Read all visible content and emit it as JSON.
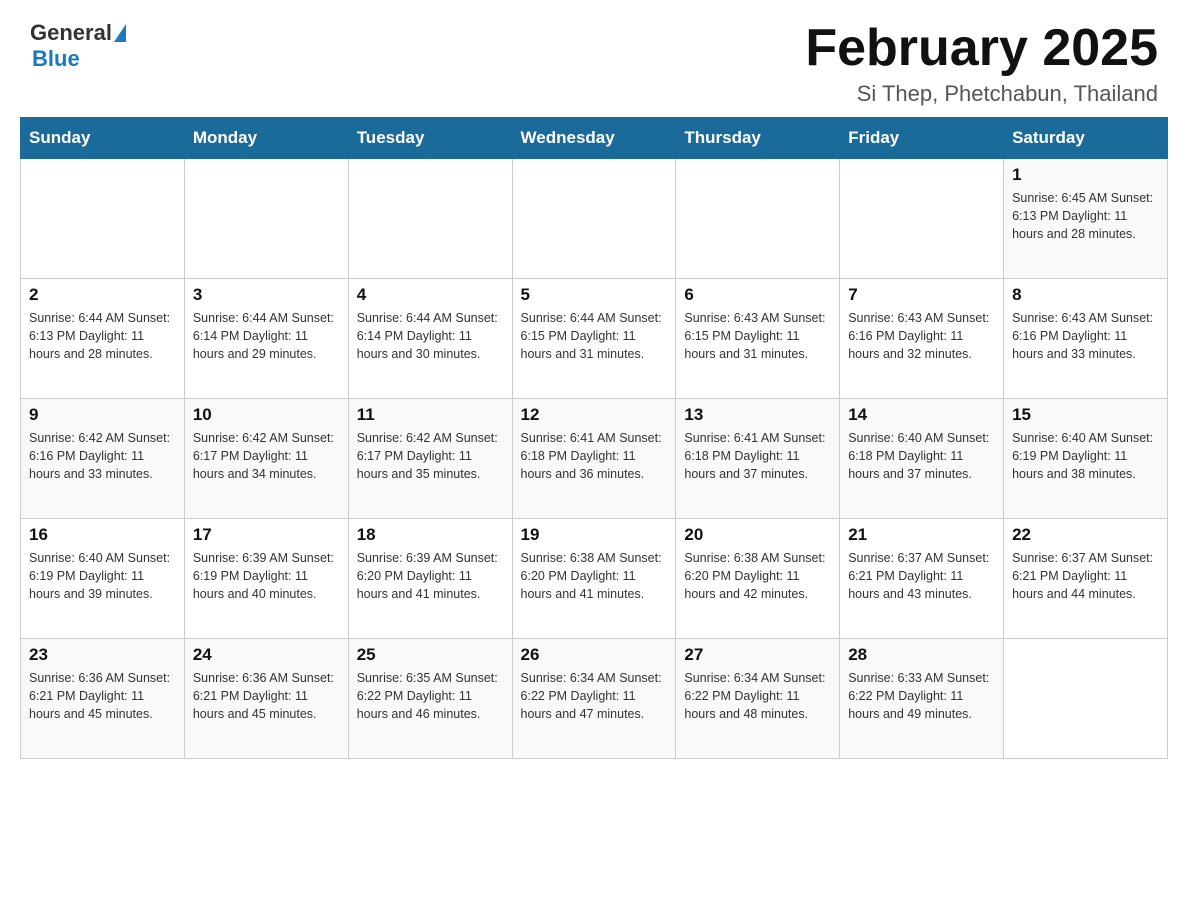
{
  "header": {
    "logo_general": "General",
    "logo_blue": "Blue",
    "title": "February 2025",
    "subtitle": "Si Thep, Phetchabun, Thailand"
  },
  "days_of_week": [
    "Sunday",
    "Monday",
    "Tuesday",
    "Wednesday",
    "Thursday",
    "Friday",
    "Saturday"
  ],
  "weeks": [
    [
      {
        "day": "",
        "info": ""
      },
      {
        "day": "",
        "info": ""
      },
      {
        "day": "",
        "info": ""
      },
      {
        "day": "",
        "info": ""
      },
      {
        "day": "",
        "info": ""
      },
      {
        "day": "",
        "info": ""
      },
      {
        "day": "1",
        "info": "Sunrise: 6:45 AM\nSunset: 6:13 PM\nDaylight: 11 hours\nand 28 minutes."
      }
    ],
    [
      {
        "day": "2",
        "info": "Sunrise: 6:44 AM\nSunset: 6:13 PM\nDaylight: 11 hours\nand 28 minutes."
      },
      {
        "day": "3",
        "info": "Sunrise: 6:44 AM\nSunset: 6:14 PM\nDaylight: 11 hours\nand 29 minutes."
      },
      {
        "day": "4",
        "info": "Sunrise: 6:44 AM\nSunset: 6:14 PM\nDaylight: 11 hours\nand 30 minutes."
      },
      {
        "day": "5",
        "info": "Sunrise: 6:44 AM\nSunset: 6:15 PM\nDaylight: 11 hours\nand 31 minutes."
      },
      {
        "day": "6",
        "info": "Sunrise: 6:43 AM\nSunset: 6:15 PM\nDaylight: 11 hours\nand 31 minutes."
      },
      {
        "day": "7",
        "info": "Sunrise: 6:43 AM\nSunset: 6:16 PM\nDaylight: 11 hours\nand 32 minutes."
      },
      {
        "day": "8",
        "info": "Sunrise: 6:43 AM\nSunset: 6:16 PM\nDaylight: 11 hours\nand 33 minutes."
      }
    ],
    [
      {
        "day": "9",
        "info": "Sunrise: 6:42 AM\nSunset: 6:16 PM\nDaylight: 11 hours\nand 33 minutes."
      },
      {
        "day": "10",
        "info": "Sunrise: 6:42 AM\nSunset: 6:17 PM\nDaylight: 11 hours\nand 34 minutes."
      },
      {
        "day": "11",
        "info": "Sunrise: 6:42 AM\nSunset: 6:17 PM\nDaylight: 11 hours\nand 35 minutes."
      },
      {
        "day": "12",
        "info": "Sunrise: 6:41 AM\nSunset: 6:18 PM\nDaylight: 11 hours\nand 36 minutes."
      },
      {
        "day": "13",
        "info": "Sunrise: 6:41 AM\nSunset: 6:18 PM\nDaylight: 11 hours\nand 37 minutes."
      },
      {
        "day": "14",
        "info": "Sunrise: 6:40 AM\nSunset: 6:18 PM\nDaylight: 11 hours\nand 37 minutes."
      },
      {
        "day": "15",
        "info": "Sunrise: 6:40 AM\nSunset: 6:19 PM\nDaylight: 11 hours\nand 38 minutes."
      }
    ],
    [
      {
        "day": "16",
        "info": "Sunrise: 6:40 AM\nSunset: 6:19 PM\nDaylight: 11 hours\nand 39 minutes."
      },
      {
        "day": "17",
        "info": "Sunrise: 6:39 AM\nSunset: 6:19 PM\nDaylight: 11 hours\nand 40 minutes."
      },
      {
        "day": "18",
        "info": "Sunrise: 6:39 AM\nSunset: 6:20 PM\nDaylight: 11 hours\nand 41 minutes."
      },
      {
        "day": "19",
        "info": "Sunrise: 6:38 AM\nSunset: 6:20 PM\nDaylight: 11 hours\nand 41 minutes."
      },
      {
        "day": "20",
        "info": "Sunrise: 6:38 AM\nSunset: 6:20 PM\nDaylight: 11 hours\nand 42 minutes."
      },
      {
        "day": "21",
        "info": "Sunrise: 6:37 AM\nSunset: 6:21 PM\nDaylight: 11 hours\nand 43 minutes."
      },
      {
        "day": "22",
        "info": "Sunrise: 6:37 AM\nSunset: 6:21 PM\nDaylight: 11 hours\nand 44 minutes."
      }
    ],
    [
      {
        "day": "23",
        "info": "Sunrise: 6:36 AM\nSunset: 6:21 PM\nDaylight: 11 hours\nand 45 minutes."
      },
      {
        "day": "24",
        "info": "Sunrise: 6:36 AM\nSunset: 6:21 PM\nDaylight: 11 hours\nand 45 minutes."
      },
      {
        "day": "25",
        "info": "Sunrise: 6:35 AM\nSunset: 6:22 PM\nDaylight: 11 hours\nand 46 minutes."
      },
      {
        "day": "26",
        "info": "Sunrise: 6:34 AM\nSunset: 6:22 PM\nDaylight: 11 hours\nand 47 minutes."
      },
      {
        "day": "27",
        "info": "Sunrise: 6:34 AM\nSunset: 6:22 PM\nDaylight: 11 hours\nand 48 minutes."
      },
      {
        "day": "28",
        "info": "Sunrise: 6:33 AM\nSunset: 6:22 PM\nDaylight: 11 hours\nand 49 minutes."
      },
      {
        "day": "",
        "info": ""
      }
    ]
  ]
}
